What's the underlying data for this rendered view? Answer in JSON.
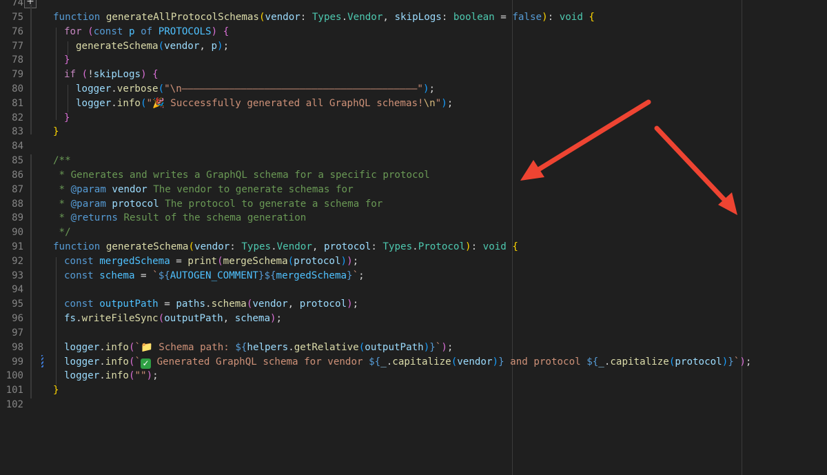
{
  "editor": {
    "line_numbers": [
      "74",
      "75",
      "76",
      "77",
      "78",
      "79",
      "80",
      "81",
      "82",
      "83",
      "84",
      "85",
      "86",
      "87",
      "88",
      "89",
      "90",
      "91",
      "92",
      "93",
      "94",
      "95",
      "96",
      "97",
      "98",
      "99",
      "100",
      "101",
      "102"
    ],
    "code": {
      "l75": {
        "kw": "function",
        "fn": "generateAllProtocolSchemas",
        "p1": "vendor",
        "ty1": "Types",
        "ty1b": "Vendor",
        "p2": "skipLogs",
        "ty2": "boolean",
        "dflt": "false",
        "ret": "void"
      },
      "l76": {
        "kw": "for",
        "const": "const",
        "v": "p",
        "of": "of",
        "c": "PROTOCOLS"
      },
      "l77": {
        "fn": "generateSchema",
        "a1": "vendor",
        "a2": "p"
      },
      "l79": {
        "kw": "if",
        "v": "skipLogs"
      },
      "l80": {
        "obj": "logger",
        "fn": "verbose",
        "str": "\"\\n————————————————————————————————————————\""
      },
      "l81": {
        "obj": "logger",
        "fn": "info",
        "emoji": "🎉",
        "str_rest": " Successfully generated all GraphQL schemas!",
        "esc": "\\n"
      },
      "l85": "/**",
      "l86": " * Generates and writes a GraphQL schema for a specific protocol",
      "l87": {
        "tag": "@param",
        "name": "vendor",
        "rest": " The vendor to generate schemas for"
      },
      "l88": {
        "tag": "@param",
        "name": "protocol",
        "rest": " The protocol to generate a schema for"
      },
      "l89": {
        "tag": "@returns",
        "rest": " Result of the schema generation"
      },
      "l90": " */",
      "l91": {
        "kw": "function",
        "fn": "generateSchema",
        "p1": "vendor",
        "ty1": "Types",
        "ty1b": "Vendor",
        "p2": "protocol",
        "ty2": "Types",
        "ty2b": "Protocol",
        "ret": "void"
      },
      "l92": {
        "kw": "const",
        "v": "mergedSchema",
        "fn1": "print",
        "fn2": "mergeSchema",
        "a": "protocol"
      },
      "l93": {
        "kw": "const",
        "v": "schema",
        "c": "AUTOGEN_COMMENT",
        "v2": "mergedSchema"
      },
      "l95": {
        "kw": "const",
        "v": "outputPath",
        "obj": "paths",
        "fn": "schema",
        "a1": "vendor",
        "a2": "protocol"
      },
      "l96": {
        "obj": "fs",
        "fn": "writeFileSync",
        "a1": "outputPath",
        "a2": "schema"
      },
      "l98": {
        "obj": "logger",
        "fn": "info",
        "emoji": "📁",
        "str": " Schema path: ",
        "obj2": "helpers",
        "fn2": "getRelative",
        "a": "outputPath"
      },
      "l99": {
        "obj": "logger",
        "fn": "info",
        "emoji": "✓",
        "str1": " Generated GraphQL schema for vendor ",
        "u": "_",
        "fn2": "capitalize",
        "a1": "vendor",
        "str2": " and protocol ",
        "a2": "protocol"
      },
      "l100": {
        "obj": "logger",
        "fn": "info",
        "str": "\"\""
      }
    },
    "add_button": "+"
  }
}
